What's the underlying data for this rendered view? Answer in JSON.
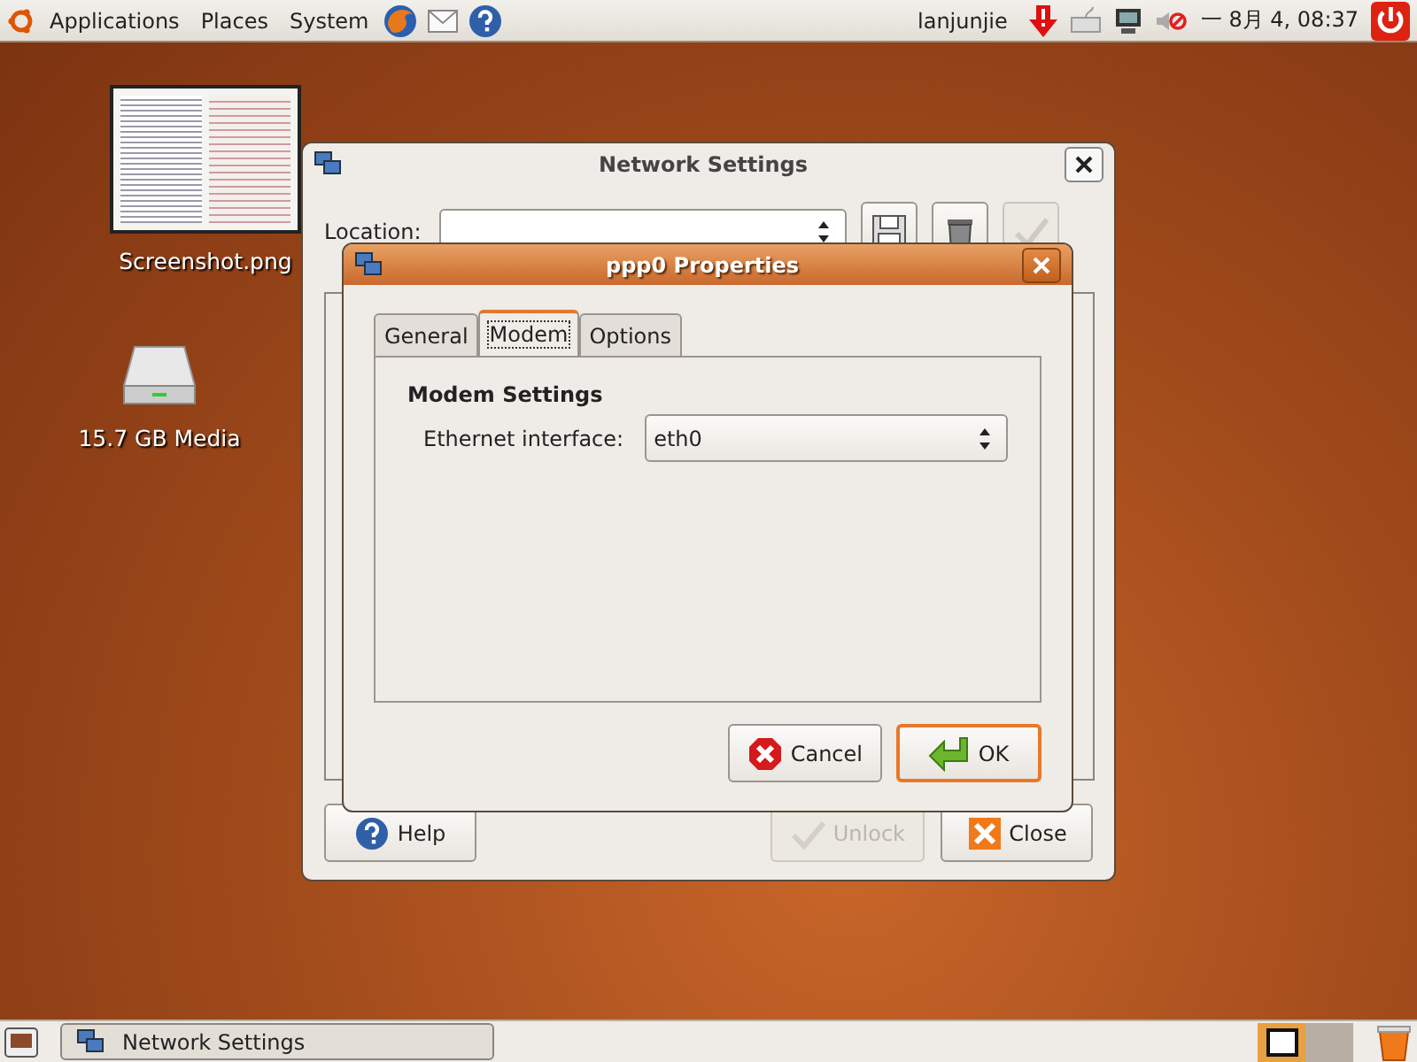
{
  "top_panel": {
    "menus": [
      "Applications",
      "Places",
      "System"
    ],
    "user": "lanjunjie",
    "clock": "一 8月 4, 08:37"
  },
  "desktop_icons": [
    {
      "label": "Screenshot.png",
      "kind": "image"
    },
    {
      "label": "15.7 GB Media",
      "kind": "drive"
    }
  ],
  "network_settings": {
    "title": "Network Settings",
    "location_label": "Location:",
    "location_buttons": [
      {
        "kind": "save",
        "disabled": false
      },
      {
        "kind": "delete",
        "disabled": false
      },
      {
        "kind": "apply",
        "disabled": true
      }
    ],
    "buttons": [
      {
        "label": "Help",
        "kind": "help",
        "disabled": false
      },
      {
        "label": "Unlock",
        "kind": "unlock",
        "disabled": true
      },
      {
        "label": "Close",
        "kind": "close",
        "disabled": false
      }
    ]
  },
  "ppp0_dialog": {
    "title": "ppp0 Properties",
    "tabs": [
      {
        "label": "General",
        "selected": false
      },
      {
        "label": "Modem",
        "selected": true
      },
      {
        "label": "Options",
        "selected": false
      }
    ],
    "section_title": "Modem Settings",
    "ethernet_label": "Ethernet interface:",
    "ethernet_value": "eth0",
    "buttons": [
      {
        "label": "Cancel",
        "kind": "cancel",
        "default": false
      },
      {
        "label": "OK",
        "kind": "ok",
        "default": true
      }
    ]
  },
  "taskbar": {
    "tasks": [
      {
        "label": "Network Settings",
        "selected": false
      }
    ],
    "workspaces": [
      {
        "selected": true
      },
      {
        "selected": false
      }
    ]
  }
}
